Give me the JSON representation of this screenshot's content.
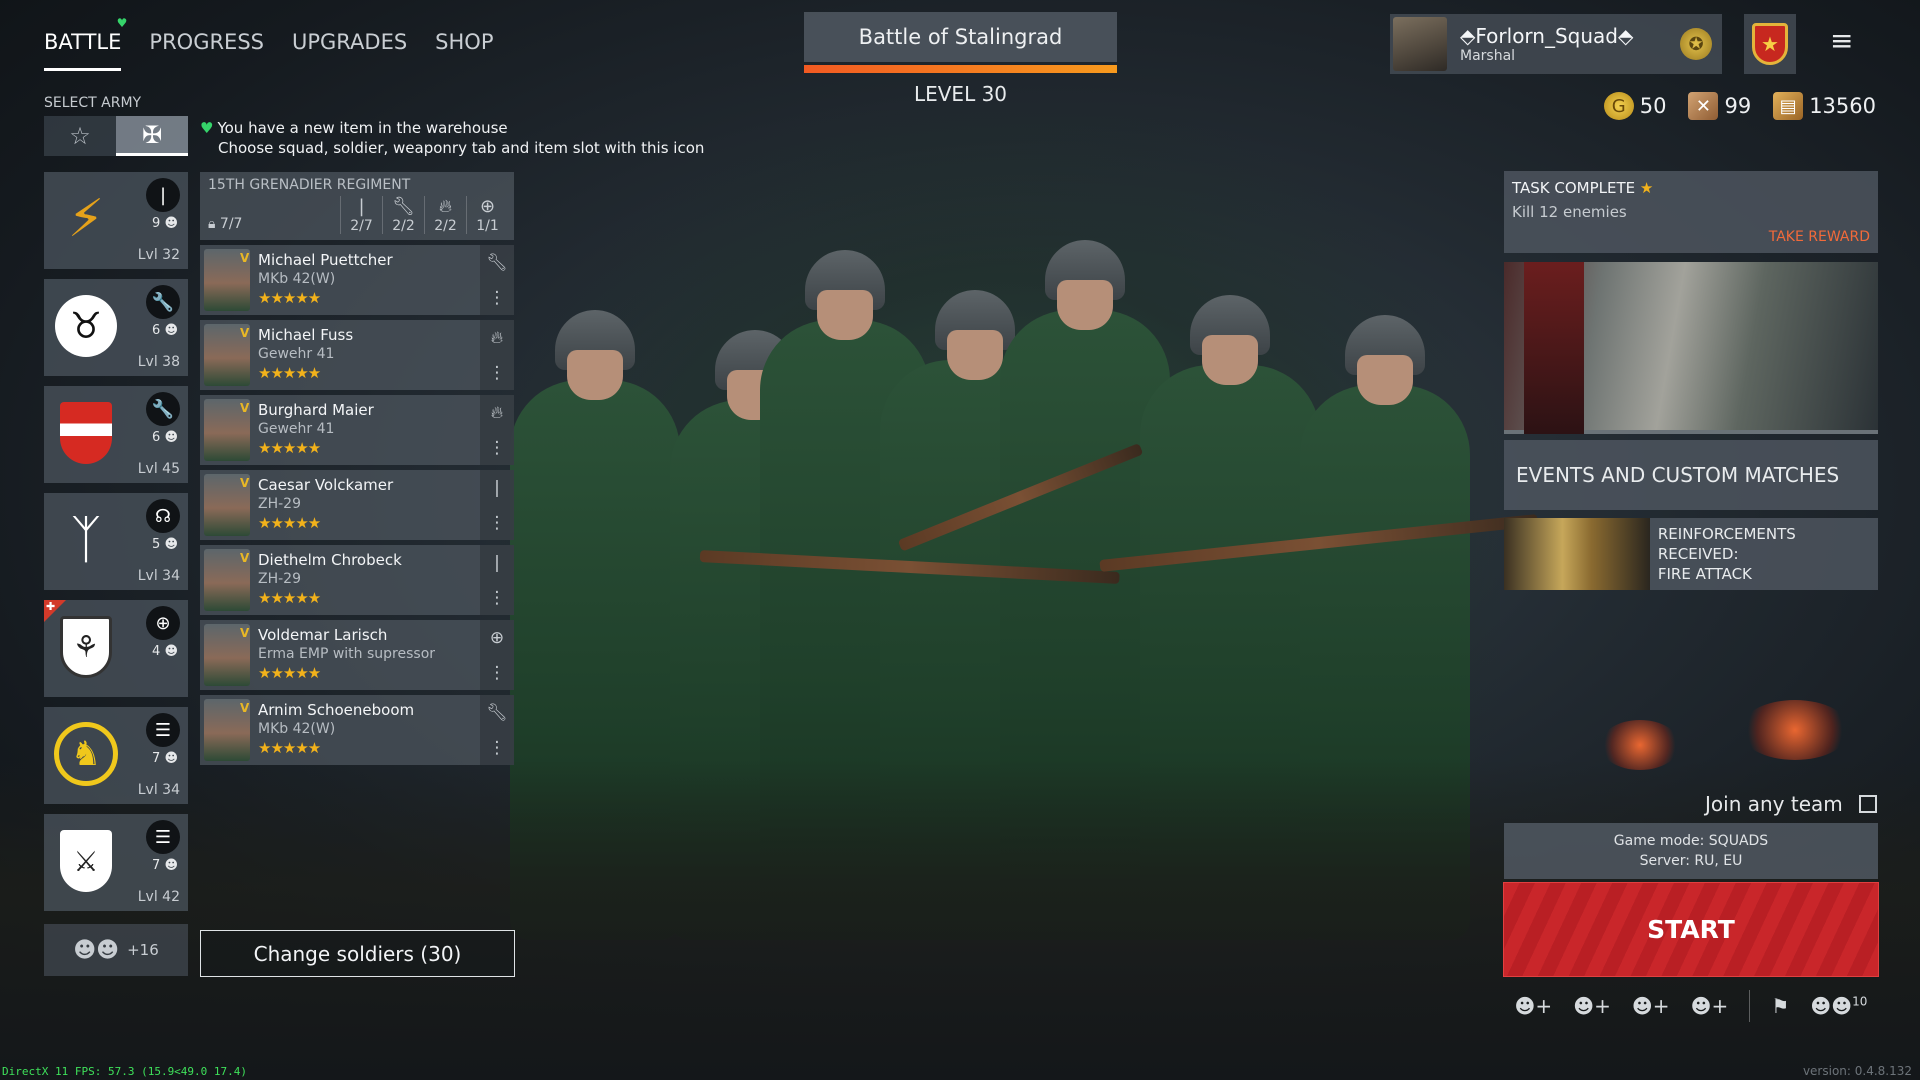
{
  "nav": {
    "tabs": [
      {
        "label": "BATTLE"
      },
      {
        "label": "PROGRESS"
      },
      {
        "label": "UPGRADES"
      },
      {
        "label": "SHOP"
      }
    ]
  },
  "select_army": {
    "label": "SELECT ARMY",
    "options": [
      {
        "icon": "star-icon"
      },
      {
        "icon": "iron-cross-icon"
      }
    ]
  },
  "notice": {
    "line1": "You have a new item in the warehouse",
    "line2": "Choose squad, soldier, weaponry tab and item slot with this icon"
  },
  "squads": [
    {
      "emblem": "rune-emblem-icon",
      "role": "rifle-role-icon",
      "count": "9",
      "level": "Lvl 32"
    },
    {
      "emblem": "bull-emblem-icon",
      "role": "engineer-role-icon",
      "count": "6",
      "level": "Lvl 38"
    },
    {
      "emblem": "red-shield-emblem-icon",
      "role": "engineer-role-icon",
      "count": "6",
      "level": "Lvl 45"
    },
    {
      "emblem": "rune-mark-emblem-icon",
      "role": "radio-role-icon",
      "count": "5",
      "level": "Lvl 34"
    },
    {
      "emblem": "oak-shield-emblem-icon",
      "role": "medic-role-icon",
      "count": "4",
      "level": ""
    },
    {
      "emblem": "horse-emblem-icon",
      "role": "list-role-icon",
      "count": "7",
      "level": "Lvl 34"
    },
    {
      "emblem": "sword-shield-emblem-icon",
      "role": "list-role-icon",
      "count": "7",
      "level": "Lvl 42"
    }
  ],
  "reserve": {
    "label": "+16"
  },
  "regiment": {
    "title": "15TH GRENADIER REGIMENT",
    "capacity": "7/7",
    "slots": [
      "2/7",
      "2/2",
      "2/2",
      "1/1"
    ]
  },
  "soldiers": [
    {
      "name": "Michael Puettcher",
      "weapon": "MKb 42(W)",
      "rank": "V",
      "stars": "★★★★★"
    },
    {
      "name": "Michael Fuss",
      "weapon": "Gewehr 41",
      "rank": "V",
      "stars": "★★★★★"
    },
    {
      "name": "Burghard Maier",
      "weapon": "Gewehr 41",
      "rank": "V",
      "stars": "★★★★★"
    },
    {
      "name": "Caesar Volckamer",
      "weapon": "ZH-29",
      "rank": "V",
      "stars": "★★★★★"
    },
    {
      "name": "Diethelm Chrobeck",
      "weapon": "ZH-29",
      "rank": "V",
      "stars": "★★★★★"
    },
    {
      "name": "Voldemar Larisch",
      "weapon": "Erma EMP with supressor",
      "rank": "V",
      "stars": "★★★★★"
    },
    {
      "name": "Arnim Schoeneboom",
      "weapon": "MKb 42(W)",
      "rank": "V",
      "stars": "★★★★★"
    }
  ],
  "change_button": {
    "label": "Change soldiers (30)"
  },
  "battle": {
    "title": "Battle of Stalingrad",
    "level": "LEVEL 30",
    "progress": 1.0
  },
  "player": {
    "name": "Forlorn_Squad",
    "rank": "Marshal"
  },
  "currencies": [
    {
      "icon": "gold-coin-icon",
      "value": "50"
    },
    {
      "icon": "ticket-icon",
      "value": "99"
    },
    {
      "icon": "gold-orders-icon",
      "value": "13560"
    }
  ],
  "task": {
    "status": "TASK COMPLETE",
    "desc": "Kill 12 enemies",
    "reward": "TAKE REWARD"
  },
  "events": {
    "label": "EVENTS AND CUSTOM MATCHES"
  },
  "reinforcements": {
    "line1": "REINFORCEMENTS RECEIVED:",
    "line2": "FIRE ATTACK"
  },
  "join": {
    "label": "Join any team",
    "checked": false
  },
  "gamemode": {
    "mode": "Game mode: SQUADS",
    "server": "Server: RU, EU"
  },
  "start": {
    "label": "START"
  },
  "squad_bar": {
    "members_count": "10"
  },
  "debug": {
    "fps": "DirectX 11 FPS: 57.3 (15.9<49.0 17.4)",
    "version": "version: 0.4.8.132"
  },
  "colors": {
    "accent": "#f26a3a",
    "start": "#c9262a",
    "stars": "#f2b21b",
    "panel": "#50585f"
  }
}
